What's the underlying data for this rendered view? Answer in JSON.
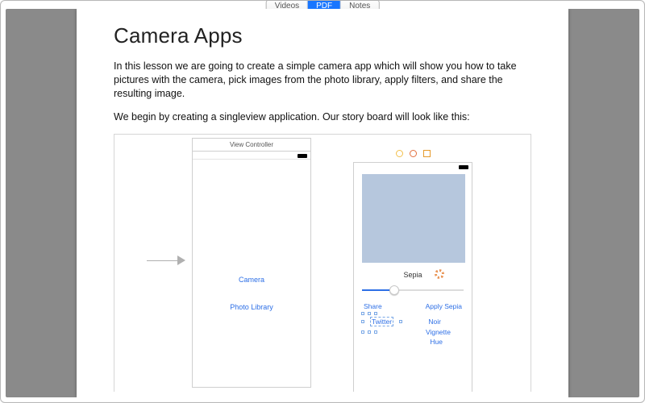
{
  "tabs": {
    "videos": "Videos",
    "pdf": "PDF",
    "notes": "Notes",
    "selected": "pdf"
  },
  "doc": {
    "title": "Camera Apps",
    "para1": "In this lesson we are going to create a simple camera app which will show you how to take pictures with the camera, pick images from the photo library, apply filters, and share the resulting image.",
    "para2": "We begin by creating a singleview application. Our story board will look like this:"
  },
  "storyboard": {
    "vc1": {
      "title": "View Controller",
      "buttons": {
        "camera": "Camera",
        "photoLibrary": "Photo Library"
      }
    },
    "vc2": {
      "currentFilter": "Sepia",
      "actions": {
        "share": "Share",
        "applySepia": "Apply Sepia",
        "twitter": "Twitter",
        "noir": "Noir",
        "vignette": "Vignette",
        "hue": "Hue"
      }
    }
  }
}
